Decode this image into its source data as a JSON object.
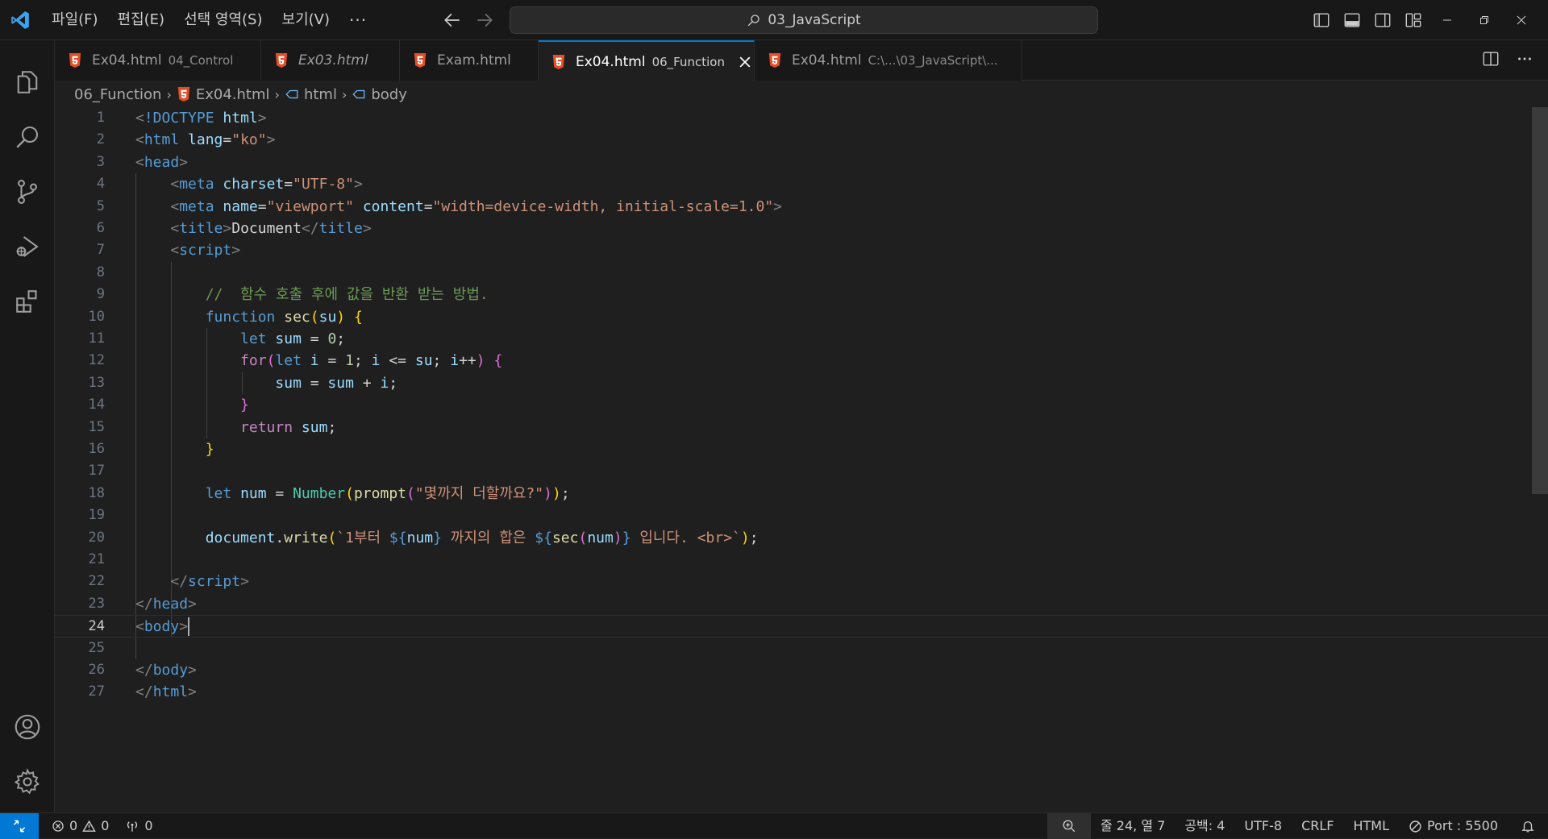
{
  "titlebar": {
    "menu": [
      "파일(F)",
      "편집(E)",
      "선택 영역(S)",
      "보기(V)"
    ],
    "more": "···",
    "search_text": "03_JavaScript"
  },
  "tabs": [
    {
      "name": "Ex04.html",
      "desc": "04_Control",
      "italic": false,
      "active": false
    },
    {
      "name": "Ex03.html",
      "desc": "",
      "italic": true,
      "active": false
    },
    {
      "name": "Exam.html",
      "desc": "",
      "italic": false,
      "active": false
    },
    {
      "name": "Ex04.html",
      "desc": "06_Function",
      "italic": false,
      "active": true
    },
    {
      "name": "Ex04.html",
      "desc": "C:\\...\\03_JavaScript\\...",
      "italic": false,
      "active": false
    }
  ],
  "breadcrumb": [
    "06_Function",
    "Ex04.html",
    "html",
    "body"
  ],
  "editor": {
    "current_line": 24,
    "lines": [
      [
        [
          "t-punct",
          "<"
        ],
        [
          "t-tag",
          "!DOCTYPE"
        ],
        [
          "t-text",
          " "
        ],
        [
          "t-attr",
          "html"
        ],
        [
          "t-punct",
          ">"
        ]
      ],
      [
        [
          "t-punct",
          "<"
        ],
        [
          "t-tag",
          "html"
        ],
        [
          "t-text",
          " "
        ],
        [
          "t-attr",
          "lang"
        ],
        [
          "t-text",
          "="
        ],
        [
          "t-str",
          "\"ko\""
        ],
        [
          "t-punct",
          ">"
        ]
      ],
      [
        [
          "t-punct",
          "<"
        ],
        [
          "t-tag",
          "head"
        ],
        [
          "t-punct",
          ">"
        ]
      ],
      [
        [
          "t-text",
          "    "
        ],
        [
          "t-punct",
          "<"
        ],
        [
          "t-tag",
          "meta"
        ],
        [
          "t-text",
          " "
        ],
        [
          "t-attr",
          "charset"
        ],
        [
          "t-text",
          "="
        ],
        [
          "t-str",
          "\"UTF-8\""
        ],
        [
          "t-punct",
          ">"
        ]
      ],
      [
        [
          "t-text",
          "    "
        ],
        [
          "t-punct",
          "<"
        ],
        [
          "t-tag",
          "meta"
        ],
        [
          "t-text",
          " "
        ],
        [
          "t-attr",
          "name"
        ],
        [
          "t-text",
          "="
        ],
        [
          "t-str",
          "\"viewport\""
        ],
        [
          "t-text",
          " "
        ],
        [
          "t-attr",
          "content"
        ],
        [
          "t-text",
          "="
        ],
        [
          "t-str",
          "\"width=device-width, initial-scale=1.0\""
        ],
        [
          "t-punct",
          ">"
        ]
      ],
      [
        [
          "t-text",
          "    "
        ],
        [
          "t-punct",
          "<"
        ],
        [
          "t-tag",
          "title"
        ],
        [
          "t-punct",
          ">"
        ],
        [
          "t-text",
          "Document"
        ],
        [
          "t-punct",
          "</"
        ],
        [
          "t-tag",
          "title"
        ],
        [
          "t-punct",
          ">"
        ]
      ],
      [
        [
          "t-text",
          "    "
        ],
        [
          "t-punct",
          "<"
        ],
        [
          "t-tag",
          "script"
        ],
        [
          "t-punct",
          ">"
        ]
      ],
      [],
      [
        [
          "t-text",
          "        "
        ],
        [
          "t-comment",
          "//  함수 호출 후에 값을 반환 받는 방법."
        ]
      ],
      [
        [
          "t-text",
          "        "
        ],
        [
          "t-kw",
          "function"
        ],
        [
          "t-text",
          " "
        ],
        [
          "t-fn",
          "sec"
        ],
        [
          "t-b1",
          "("
        ],
        [
          "t-var",
          "su"
        ],
        [
          "t-b1",
          ")"
        ],
        [
          "t-text",
          " "
        ],
        [
          "t-b1",
          "{"
        ]
      ],
      [
        [
          "t-text",
          "            "
        ],
        [
          "t-kw",
          "let"
        ],
        [
          "t-text",
          " "
        ],
        [
          "t-var",
          "sum"
        ],
        [
          "t-text",
          " = "
        ],
        [
          "t-num",
          "0"
        ],
        [
          "t-text",
          ";"
        ]
      ],
      [
        [
          "t-text",
          "            "
        ],
        [
          "t-ctrl",
          "for"
        ],
        [
          "t-b2",
          "("
        ],
        [
          "t-kw",
          "let"
        ],
        [
          "t-text",
          " "
        ],
        [
          "t-var",
          "i"
        ],
        [
          "t-text",
          " = "
        ],
        [
          "t-num",
          "1"
        ],
        [
          "t-text",
          "; "
        ],
        [
          "t-var",
          "i"
        ],
        [
          "t-text",
          " <= "
        ],
        [
          "t-var",
          "su"
        ],
        [
          "t-text",
          "; "
        ],
        [
          "t-var",
          "i"
        ],
        [
          "t-text",
          "++"
        ],
        [
          "t-b2",
          ")"
        ],
        [
          "t-text",
          " "
        ],
        [
          "t-b2",
          "{"
        ]
      ],
      [
        [
          "t-text",
          "                "
        ],
        [
          "t-var",
          "sum"
        ],
        [
          "t-text",
          " = "
        ],
        [
          "t-var",
          "sum"
        ],
        [
          "t-text",
          " + "
        ],
        [
          "t-var",
          "i"
        ],
        [
          "t-text",
          ";"
        ]
      ],
      [
        [
          "t-text",
          "            "
        ],
        [
          "t-b2",
          "}"
        ]
      ],
      [
        [
          "t-text",
          "            "
        ],
        [
          "t-ctrl",
          "return"
        ],
        [
          "t-text",
          " "
        ],
        [
          "t-var",
          "sum"
        ],
        [
          "t-text",
          ";"
        ]
      ],
      [
        [
          "t-text",
          "        "
        ],
        [
          "t-b1",
          "}"
        ]
      ],
      [],
      [
        [
          "t-text",
          "        "
        ],
        [
          "t-kw",
          "let"
        ],
        [
          "t-text",
          " "
        ],
        [
          "t-var",
          "num"
        ],
        [
          "t-text",
          " = "
        ],
        [
          "t-type",
          "Number"
        ],
        [
          "t-b1",
          "("
        ],
        [
          "t-fn",
          "prompt"
        ],
        [
          "t-b2",
          "("
        ],
        [
          "t-str",
          "\"몇까지 더할까요?\""
        ],
        [
          "t-b2",
          ")"
        ],
        [
          "t-b1",
          ")"
        ],
        [
          "t-text",
          ";"
        ]
      ],
      [],
      [
        [
          "t-text",
          "        "
        ],
        [
          "t-var",
          "document"
        ],
        [
          "t-text",
          "."
        ],
        [
          "t-fn",
          "write"
        ],
        [
          "t-b1",
          "("
        ],
        [
          "t-str",
          "`1부터 "
        ],
        [
          "t-kw",
          "${"
        ],
        [
          "t-var",
          "num"
        ],
        [
          "t-kw",
          "}"
        ],
        [
          "t-str",
          " 까지의 합은 "
        ],
        [
          "t-kw",
          "${"
        ],
        [
          "t-fn",
          "sec"
        ],
        [
          "t-b2",
          "("
        ],
        [
          "t-var",
          "num"
        ],
        [
          "t-b2",
          ")"
        ],
        [
          "t-kw",
          "}"
        ],
        [
          "t-str",
          " 입니다. <br>`"
        ],
        [
          "t-b1",
          ")"
        ],
        [
          "t-text",
          ";"
        ]
      ],
      [],
      [
        [
          "t-text",
          "    "
        ],
        [
          "t-punct",
          "</"
        ],
        [
          "t-tag",
          "script"
        ],
        [
          "t-punct",
          ">"
        ]
      ],
      [
        [
          "t-punct",
          "</"
        ],
        [
          "t-tag",
          "head"
        ],
        [
          "t-punct",
          ">"
        ]
      ],
      [
        [
          "t-punct",
          "<"
        ],
        [
          "t-tag",
          "body"
        ],
        [
          "t-punct",
          ">"
        ]
      ],
      [],
      [
        [
          "t-punct",
          "</"
        ],
        [
          "t-tag",
          "body"
        ],
        [
          "t-punct",
          ">"
        ]
      ],
      [
        [
          "t-punct",
          "</"
        ],
        [
          "t-tag",
          "html"
        ],
        [
          "t-punct",
          ">"
        ]
      ]
    ]
  },
  "statusbar": {
    "errors": "0",
    "warnings": "0",
    "ports": "0",
    "position": "줄 24, 열 7",
    "spaces": "공백: 4",
    "encoding": "UTF-8",
    "eol": "CRLF",
    "language": "HTML",
    "port": "Port : 5500"
  },
  "colors": {
    "accent": "#0078d4",
    "html_icon": "#e44d26"
  }
}
